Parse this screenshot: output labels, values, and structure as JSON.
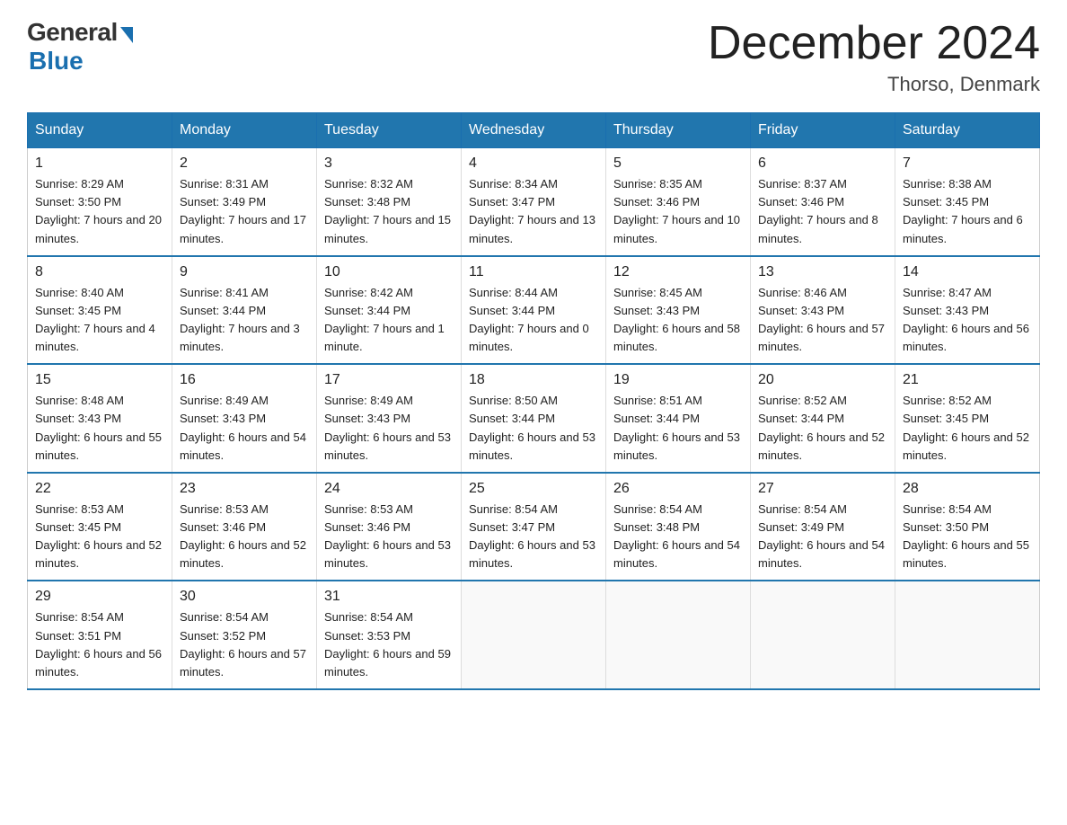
{
  "logo": {
    "general": "General",
    "blue": "Blue"
  },
  "title": "December 2024",
  "location": "Thorso, Denmark",
  "weekdays": [
    "Sunday",
    "Monday",
    "Tuesday",
    "Wednesday",
    "Thursday",
    "Friday",
    "Saturday"
  ],
  "weeks": [
    [
      {
        "day": "1",
        "sunrise": "8:29 AM",
        "sunset": "3:50 PM",
        "daylight": "7 hours and 20 minutes."
      },
      {
        "day": "2",
        "sunrise": "8:31 AM",
        "sunset": "3:49 PM",
        "daylight": "7 hours and 17 minutes."
      },
      {
        "day": "3",
        "sunrise": "8:32 AM",
        "sunset": "3:48 PM",
        "daylight": "7 hours and 15 minutes."
      },
      {
        "day": "4",
        "sunrise": "8:34 AM",
        "sunset": "3:47 PM",
        "daylight": "7 hours and 13 minutes."
      },
      {
        "day": "5",
        "sunrise": "8:35 AM",
        "sunset": "3:46 PM",
        "daylight": "7 hours and 10 minutes."
      },
      {
        "day": "6",
        "sunrise": "8:37 AM",
        "sunset": "3:46 PM",
        "daylight": "7 hours and 8 minutes."
      },
      {
        "day": "7",
        "sunrise": "8:38 AM",
        "sunset": "3:45 PM",
        "daylight": "7 hours and 6 minutes."
      }
    ],
    [
      {
        "day": "8",
        "sunrise": "8:40 AM",
        "sunset": "3:45 PM",
        "daylight": "7 hours and 4 minutes."
      },
      {
        "day": "9",
        "sunrise": "8:41 AM",
        "sunset": "3:44 PM",
        "daylight": "7 hours and 3 minutes."
      },
      {
        "day": "10",
        "sunrise": "8:42 AM",
        "sunset": "3:44 PM",
        "daylight": "7 hours and 1 minute."
      },
      {
        "day": "11",
        "sunrise": "8:44 AM",
        "sunset": "3:44 PM",
        "daylight": "7 hours and 0 minutes."
      },
      {
        "day": "12",
        "sunrise": "8:45 AM",
        "sunset": "3:43 PM",
        "daylight": "6 hours and 58 minutes."
      },
      {
        "day": "13",
        "sunrise": "8:46 AM",
        "sunset": "3:43 PM",
        "daylight": "6 hours and 57 minutes."
      },
      {
        "day": "14",
        "sunrise": "8:47 AM",
        "sunset": "3:43 PM",
        "daylight": "6 hours and 56 minutes."
      }
    ],
    [
      {
        "day": "15",
        "sunrise": "8:48 AM",
        "sunset": "3:43 PM",
        "daylight": "6 hours and 55 minutes."
      },
      {
        "day": "16",
        "sunrise": "8:49 AM",
        "sunset": "3:43 PM",
        "daylight": "6 hours and 54 minutes."
      },
      {
        "day": "17",
        "sunrise": "8:49 AM",
        "sunset": "3:43 PM",
        "daylight": "6 hours and 53 minutes."
      },
      {
        "day": "18",
        "sunrise": "8:50 AM",
        "sunset": "3:44 PM",
        "daylight": "6 hours and 53 minutes."
      },
      {
        "day": "19",
        "sunrise": "8:51 AM",
        "sunset": "3:44 PM",
        "daylight": "6 hours and 53 minutes."
      },
      {
        "day": "20",
        "sunrise": "8:52 AM",
        "sunset": "3:44 PM",
        "daylight": "6 hours and 52 minutes."
      },
      {
        "day": "21",
        "sunrise": "8:52 AM",
        "sunset": "3:45 PM",
        "daylight": "6 hours and 52 minutes."
      }
    ],
    [
      {
        "day": "22",
        "sunrise": "8:53 AM",
        "sunset": "3:45 PM",
        "daylight": "6 hours and 52 minutes."
      },
      {
        "day": "23",
        "sunrise": "8:53 AM",
        "sunset": "3:46 PM",
        "daylight": "6 hours and 52 minutes."
      },
      {
        "day": "24",
        "sunrise": "8:53 AM",
        "sunset": "3:46 PM",
        "daylight": "6 hours and 53 minutes."
      },
      {
        "day": "25",
        "sunrise": "8:54 AM",
        "sunset": "3:47 PM",
        "daylight": "6 hours and 53 minutes."
      },
      {
        "day": "26",
        "sunrise": "8:54 AM",
        "sunset": "3:48 PM",
        "daylight": "6 hours and 54 minutes."
      },
      {
        "day": "27",
        "sunrise": "8:54 AM",
        "sunset": "3:49 PM",
        "daylight": "6 hours and 54 minutes."
      },
      {
        "day": "28",
        "sunrise": "8:54 AM",
        "sunset": "3:50 PM",
        "daylight": "6 hours and 55 minutes."
      }
    ],
    [
      {
        "day": "29",
        "sunrise": "8:54 AM",
        "sunset": "3:51 PM",
        "daylight": "6 hours and 56 minutes."
      },
      {
        "day": "30",
        "sunrise": "8:54 AM",
        "sunset": "3:52 PM",
        "daylight": "6 hours and 57 minutes."
      },
      {
        "day": "31",
        "sunrise": "8:54 AM",
        "sunset": "3:53 PM",
        "daylight": "6 hours and 59 minutes."
      },
      null,
      null,
      null,
      null
    ]
  ]
}
